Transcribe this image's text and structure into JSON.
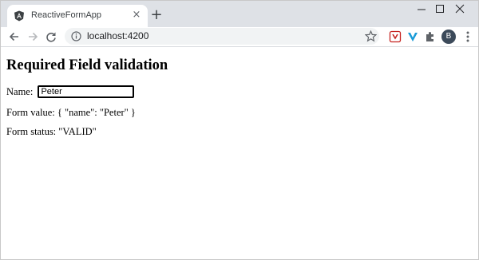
{
  "browser": {
    "tab_title": "ReactiveFormApp",
    "tab_favicon": "angular-logo-icon",
    "tab_close": "×",
    "new_tab": "+",
    "url": "localhost:4200",
    "profile_initial": "B",
    "extensions": [
      "pdf-extension-icon",
      "v-extension-icon",
      "puzzle-extensions-icon"
    ]
  },
  "page": {
    "heading": "Required Field validation",
    "name_label": "Name:",
    "name_value": "Peter",
    "form_value_text": "Form value: { \"name\": \"Peter\" }",
    "form_status_text": "Form status: \"VALID\""
  },
  "colors": {
    "tabstrip": "#dee1e6",
    "omnibox": "#f1f3f4",
    "accent_red": "#c5221f",
    "accent_teal": "#1a9bd7"
  }
}
